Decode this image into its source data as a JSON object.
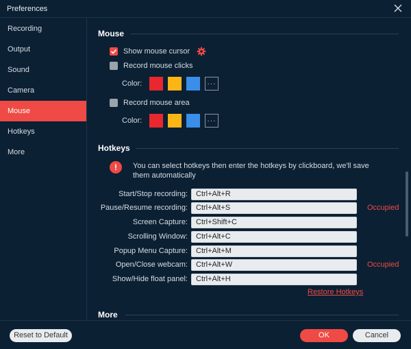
{
  "window": {
    "title": "Preferences"
  },
  "sidebar": {
    "items": [
      {
        "label": "Recording"
      },
      {
        "label": "Output"
      },
      {
        "label": "Sound"
      },
      {
        "label": "Camera"
      },
      {
        "label": "Mouse"
      },
      {
        "label": "Hotkeys"
      },
      {
        "label": "More"
      }
    ],
    "active": "Mouse"
  },
  "mouse": {
    "title": "Mouse",
    "show_cursor": {
      "label": "Show mouse cursor",
      "checked": true
    },
    "record_clicks": {
      "label": "Record mouse clicks",
      "checked": false
    },
    "record_area": {
      "label": "Record mouse area",
      "checked": false
    },
    "color_label": "Color:",
    "colors": [
      "#e8282e",
      "#fbb616",
      "#3b8ee9"
    ],
    "more_colors": "···"
  },
  "hotkeys": {
    "title": "Hotkeys",
    "notice": "You can select hotkeys then enter the hotkeys by clickboard, we'll save them automatically",
    "rows": [
      {
        "label": "Start/Stop recording:",
        "value": "Ctrl+Alt+R",
        "status": ""
      },
      {
        "label": "Pause/Resume recording:",
        "value": "Ctrl+Alt+S",
        "status": "Occupied"
      },
      {
        "label": "Screen Capture:",
        "value": "Ctrl+Shift+C",
        "status": ""
      },
      {
        "label": "Scrolling Window:",
        "value": "Ctrl+Alt+C",
        "status": ""
      },
      {
        "label": "Popup Menu Capture:",
        "value": "Ctrl+Alt+M",
        "status": ""
      },
      {
        "label": "Open/Close webcam:",
        "value": "Ctrl+Alt+W",
        "status": "Occupied"
      },
      {
        "label": "Show/Hide float panel:",
        "value": "Ctrl+Alt+H",
        "status": ""
      }
    ],
    "restore": "Restore Hotkeys"
  },
  "more": {
    "title": "More"
  },
  "footer": {
    "reset": "Reset to Default",
    "ok": "OK",
    "cancel": "Cancel"
  },
  "colors": {
    "accent": "#ef4a45",
    "background": "#0c2033"
  }
}
